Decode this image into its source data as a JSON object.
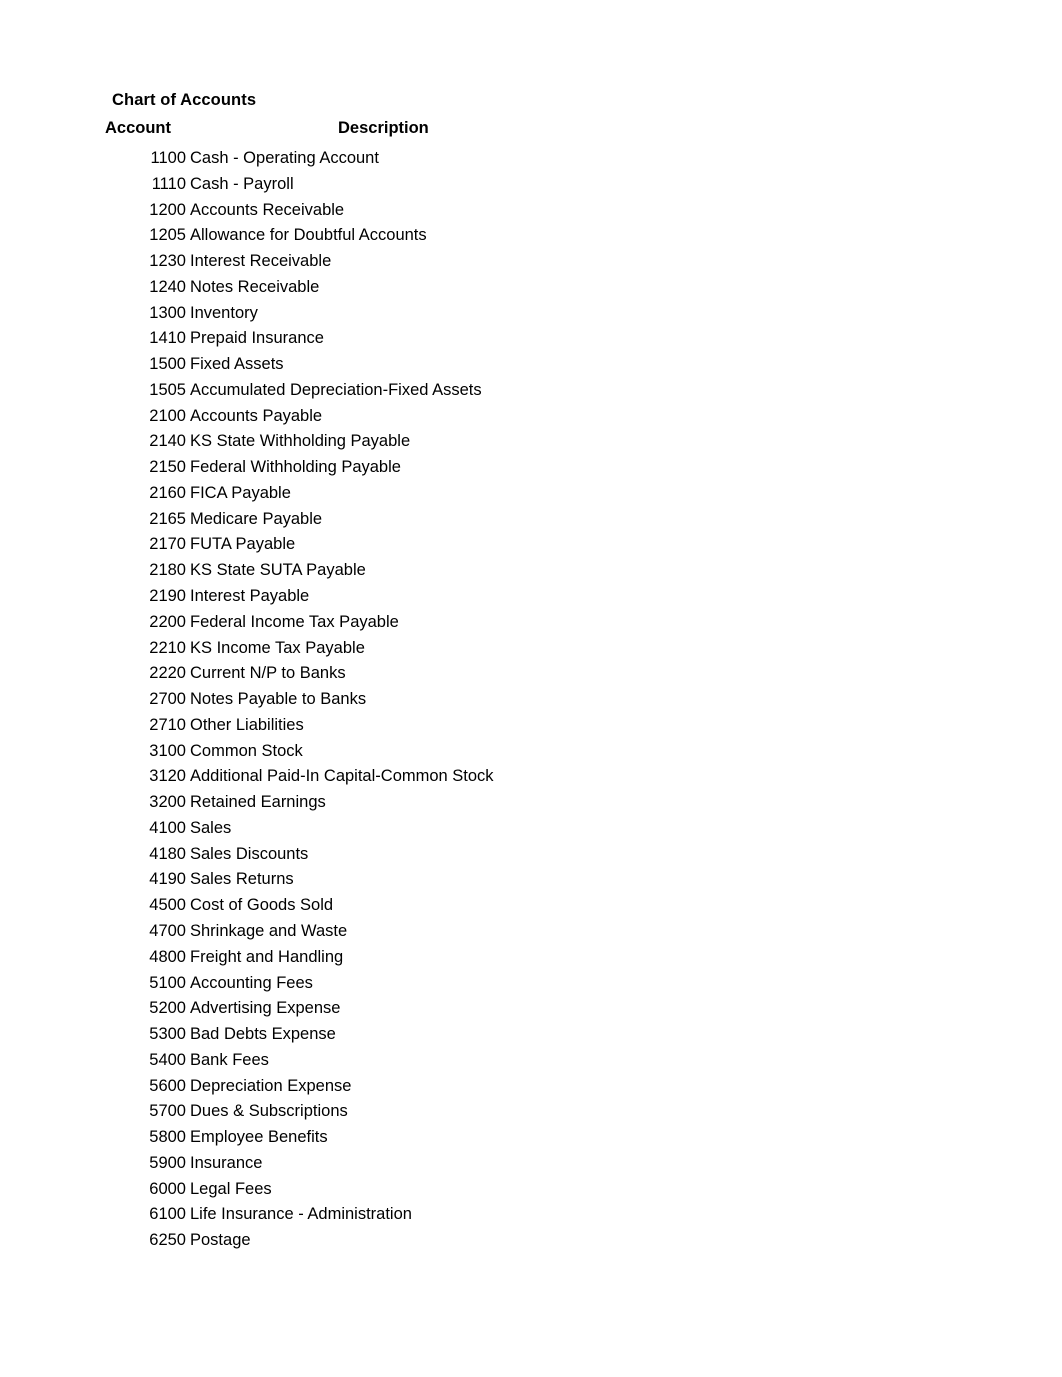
{
  "document": {
    "title": "Chart of Accounts",
    "page_background": "#ffffff",
    "text_color": "#000000"
  },
  "table": {
    "headers": {
      "account": "Account",
      "description": "Description"
    },
    "rows": [
      {
        "account": "1100",
        "description": "Cash - Operating Account"
      },
      {
        "account": "1110",
        "description": "Cash - Payroll"
      },
      {
        "account": "1200",
        "description": "Accounts Receivable"
      },
      {
        "account": "1205",
        "description": "Allowance for Doubtful Accounts"
      },
      {
        "account": "1230",
        "description": "Interest Receivable"
      },
      {
        "account": "1240",
        "description": "Notes Receivable"
      },
      {
        "account": "1300",
        "description": "Inventory"
      },
      {
        "account": "1410",
        "description": "Prepaid Insurance"
      },
      {
        "account": "1500",
        "description": "Fixed Assets"
      },
      {
        "account": "1505",
        "description": "Accumulated Depreciation-Fixed Assets"
      },
      {
        "account": "2100",
        "description": "Accounts Payable"
      },
      {
        "account": "2140",
        "description": "KS State Withholding Payable"
      },
      {
        "account": "2150",
        "description": "Federal Withholding Payable"
      },
      {
        "account": "2160",
        "description": "FICA Payable"
      },
      {
        "account": "2165",
        "description": "Medicare Payable"
      },
      {
        "account": "2170",
        "description": "FUTA Payable"
      },
      {
        "account": "2180",
        "description": "KS State SUTA Payable"
      },
      {
        "account": "2190",
        "description": "Interest Payable"
      },
      {
        "account": "2200",
        "description": "Federal Income Tax Payable"
      },
      {
        "account": "2210",
        "description": "KS Income Tax Payable"
      },
      {
        "account": "2220",
        "description": "Current N/P to Banks"
      },
      {
        "account": "2700",
        "description": "Notes Payable to Banks"
      },
      {
        "account": "2710",
        "description": "Other Liabilities"
      },
      {
        "account": "3100",
        "description": "Common Stock"
      },
      {
        "account": "3120",
        "description": "Additional Paid-In Capital-Common Stock"
      },
      {
        "account": "3200",
        "description": "Retained Earnings"
      },
      {
        "account": "4100",
        "description": "Sales"
      },
      {
        "account": "4180",
        "description": "Sales Discounts"
      },
      {
        "account": "4190",
        "description": "Sales Returns"
      },
      {
        "account": "4500",
        "description": "Cost of Goods Sold"
      },
      {
        "account": "4700",
        "description": "Shrinkage and Waste"
      },
      {
        "account": "4800",
        "description": "Freight and Handling"
      },
      {
        "account": "5100",
        "description": "Accounting Fees"
      },
      {
        "account": "5200",
        "description": "Advertising Expense"
      },
      {
        "account": "5300",
        "description": "Bad Debts Expense"
      },
      {
        "account": "5400",
        "description": "Bank Fees"
      },
      {
        "account": "5600",
        "description": "Depreciation Expense"
      },
      {
        "account": "5700",
        "description": "Dues & Subscriptions"
      },
      {
        "account": "5800",
        "description": "Employee Benefits"
      },
      {
        "account": "5900",
        "description": "Insurance"
      },
      {
        "account": "6000",
        "description": "Legal Fees"
      },
      {
        "account": "6100",
        "description": "Life Insurance - Administration"
      },
      {
        "account": "6250",
        "description": "Postage"
      }
    ]
  }
}
